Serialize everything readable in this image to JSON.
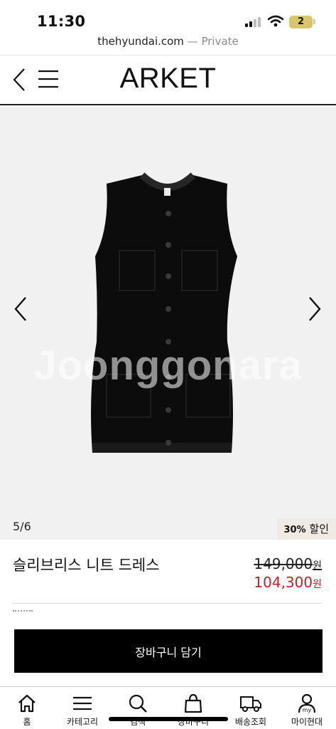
{
  "status": {
    "time": "11:30",
    "battery": "2"
  },
  "browser": {
    "domain": "thehyundai.com",
    "separator": " — ",
    "mode": "Private"
  },
  "header": {
    "logo": "ARKET"
  },
  "gallery": {
    "counter": "5/6",
    "discount_pct": "30%",
    "discount_word": " 할인",
    "watermark": "Joonggonara"
  },
  "product": {
    "name": "슬리브리스 니트 드레스",
    "original_price": "149,000",
    "sale_price": "104,300",
    "currency": "원"
  },
  "actions": {
    "add_to_cart": "장바구니 담기"
  },
  "tabbar": [
    {
      "label": "홈",
      "icon": "home-icon"
    },
    {
      "label": "카테고리",
      "icon": "hamburger-menu-icon"
    },
    {
      "label": "검색",
      "icon": "search-icon"
    },
    {
      "label": "장바구니",
      "icon": "shopping-bag-icon"
    },
    {
      "label": "배송조회",
      "icon": "delivery-truck-icon"
    },
    {
      "label": "마이현대",
      "icon": "my-person-icon"
    }
  ]
}
